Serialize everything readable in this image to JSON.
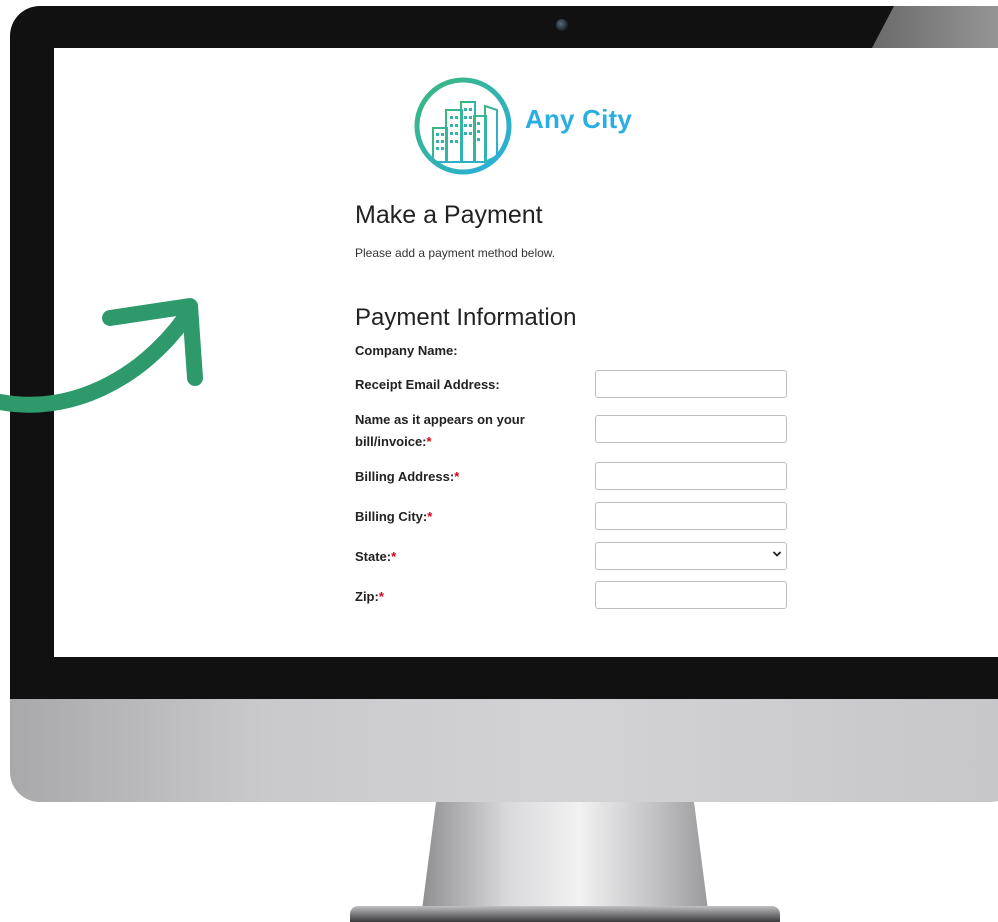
{
  "brand": {
    "name": "Any City"
  },
  "page": {
    "title": "Make a Payment",
    "subtitle": "Please add a payment method below."
  },
  "section": {
    "title": "Payment Information"
  },
  "form": {
    "required_marker": "*",
    "company_name": {
      "label": "Company Name:"
    },
    "receipt_email": {
      "label": "Receipt Email Address:",
      "value": ""
    },
    "name_on_bill": {
      "label_line1": "Name as it appears on your",
      "label_line2": "bill/invoice:",
      "value": ""
    },
    "billing_address": {
      "label": "Billing Address:",
      "value": ""
    },
    "billing_city": {
      "label": "Billing City:",
      "value": ""
    },
    "state": {
      "label": "State:",
      "selected": ""
    },
    "zip": {
      "label": "Zip:",
      "value": ""
    }
  },
  "colors": {
    "brand_blue": "#29aee3",
    "logo_green": "#3bb878",
    "arrow_green": "#2e9a6c",
    "required_red": "#d0021b"
  },
  "icons": {
    "logo": "city-skyline-icon",
    "arrow": "curved-arrow-icon",
    "select": "chevron-down-icon"
  }
}
